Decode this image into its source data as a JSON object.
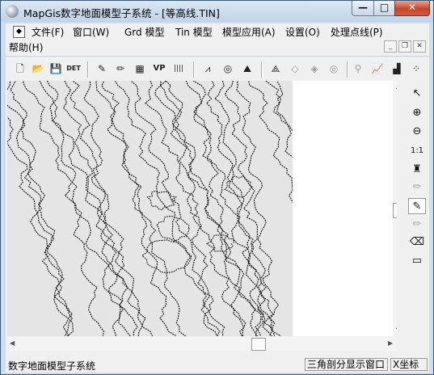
{
  "window": {
    "title": "MapGis数字地面模型子系统 - [等高线.TIN]",
    "controls": {
      "minimize": "—",
      "maximize": "□",
      "close": "✕"
    }
  },
  "menubar": {
    "items": [
      {
        "label": "文件(F)"
      },
      {
        "label": "窗口(W)"
      },
      {
        "label": "Grd 模型"
      },
      {
        "label": "Tin 模型"
      },
      {
        "label": "模型应用(A)"
      },
      {
        "label": "设置(O)"
      },
      {
        "label": "处理点线(P)"
      },
      {
        "label": "帮助(H)"
      }
    ],
    "mdi_controls": {
      "minimize": "_",
      "restore": "❐",
      "close": "✕"
    }
  },
  "toolbar": {
    "buttons": [
      {
        "icon": "new-file-icon",
        "glyph": "🗋"
      },
      {
        "icon": "open-folder-icon",
        "glyph": "📂"
      },
      {
        "icon": "save-icon",
        "glyph": "💾"
      },
      {
        "icon": "det-icon",
        "glyph": "DET"
      },
      {
        "icon": "pen-icon",
        "glyph": "✎"
      },
      {
        "icon": "pencil-icon",
        "glyph": "✏"
      },
      {
        "icon": "grid-icon",
        "glyph": "▦"
      },
      {
        "icon": "vp-icon",
        "glyph": "VP"
      },
      {
        "icon": "barcode-icon",
        "glyph": "||||"
      },
      {
        "icon": "contour-lines-icon",
        "glyph": "⩘"
      },
      {
        "icon": "contour-rings-icon",
        "glyph": "◎"
      },
      {
        "icon": "terrain-icon",
        "glyph": "⛰"
      },
      {
        "icon": "wireframe-icon",
        "glyph": "⟁"
      },
      {
        "icon": "wire-mesh-icon",
        "glyph": "◇"
      },
      {
        "icon": "shaded-mesh-icon",
        "glyph": "◈"
      },
      {
        "icon": "rings-grey-icon",
        "glyph": "◎"
      },
      {
        "icon": "point-icon",
        "glyph": "⚲"
      },
      {
        "icon": "profile-chart-icon",
        "glyph": "📈"
      },
      {
        "icon": "shaded-relief-icon",
        "glyph": "▟"
      },
      {
        "icon": "scatter-points-icon",
        "glyph": "⁘"
      }
    ]
  },
  "sidebar_tools": [
    {
      "icon": "select-arrow-icon",
      "glyph": "↖"
    },
    {
      "icon": "zoom-in-icon",
      "glyph": "⊕"
    },
    {
      "icon": "zoom-out-icon",
      "glyph": "⊖"
    },
    {
      "icon": "actual-size-icon",
      "glyph": "1:1"
    },
    {
      "icon": "brush-icon",
      "glyph": "♜"
    },
    {
      "icon": "pencil-grey-icon",
      "glyph": "✏"
    },
    {
      "icon": "edit-pencil-icon",
      "glyph": "✎"
    },
    {
      "icon": "pencil-grey-icon-2",
      "glyph": "✏"
    },
    {
      "icon": "eraser-icon",
      "glyph": "⌫"
    },
    {
      "icon": "layers-icon",
      "glyph": "▭"
    }
  ],
  "scrollbar_arrows": {
    "up": "▲",
    "down": "▼",
    "left": "◀",
    "right": "▶"
  },
  "statusbar": {
    "left": "数字地面模型子系统",
    "mode": "三角剖分显示窗口",
    "coord": "X坐标"
  },
  "colors": {
    "contour": "#111111",
    "map_background": "#e5e5e5",
    "titlebar": "#c9daec"
  }
}
